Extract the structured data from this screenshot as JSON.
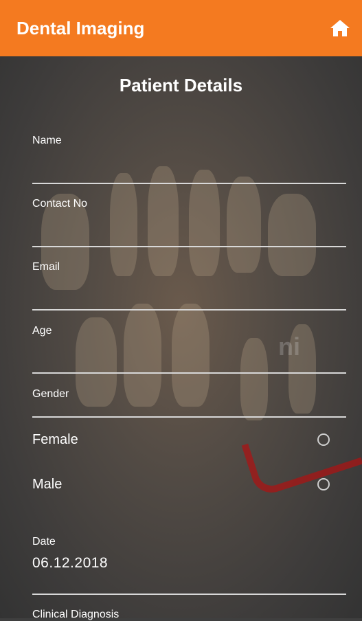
{
  "appbar": {
    "title": "Dental Imaging",
    "home_icon": "home-icon"
  },
  "page_title": "Patient Details",
  "fields": {
    "name": {
      "label": "Name",
      "value": ""
    },
    "contact": {
      "label": "Contact No",
      "value": ""
    },
    "email": {
      "label": "Email",
      "value": ""
    },
    "age": {
      "label": "Age",
      "value": ""
    },
    "gender": {
      "label": "Gender",
      "options": [
        "Female",
        "Male"
      ]
    },
    "date": {
      "label": "Date",
      "value": "06.12.2018"
    },
    "clinical": {
      "label": "Clinical Diagnosis"
    }
  },
  "colors": {
    "accent": "#f47a20",
    "overlay": "#3f3f3f",
    "text": "#ffffff",
    "underline": "#d8d8d8"
  }
}
